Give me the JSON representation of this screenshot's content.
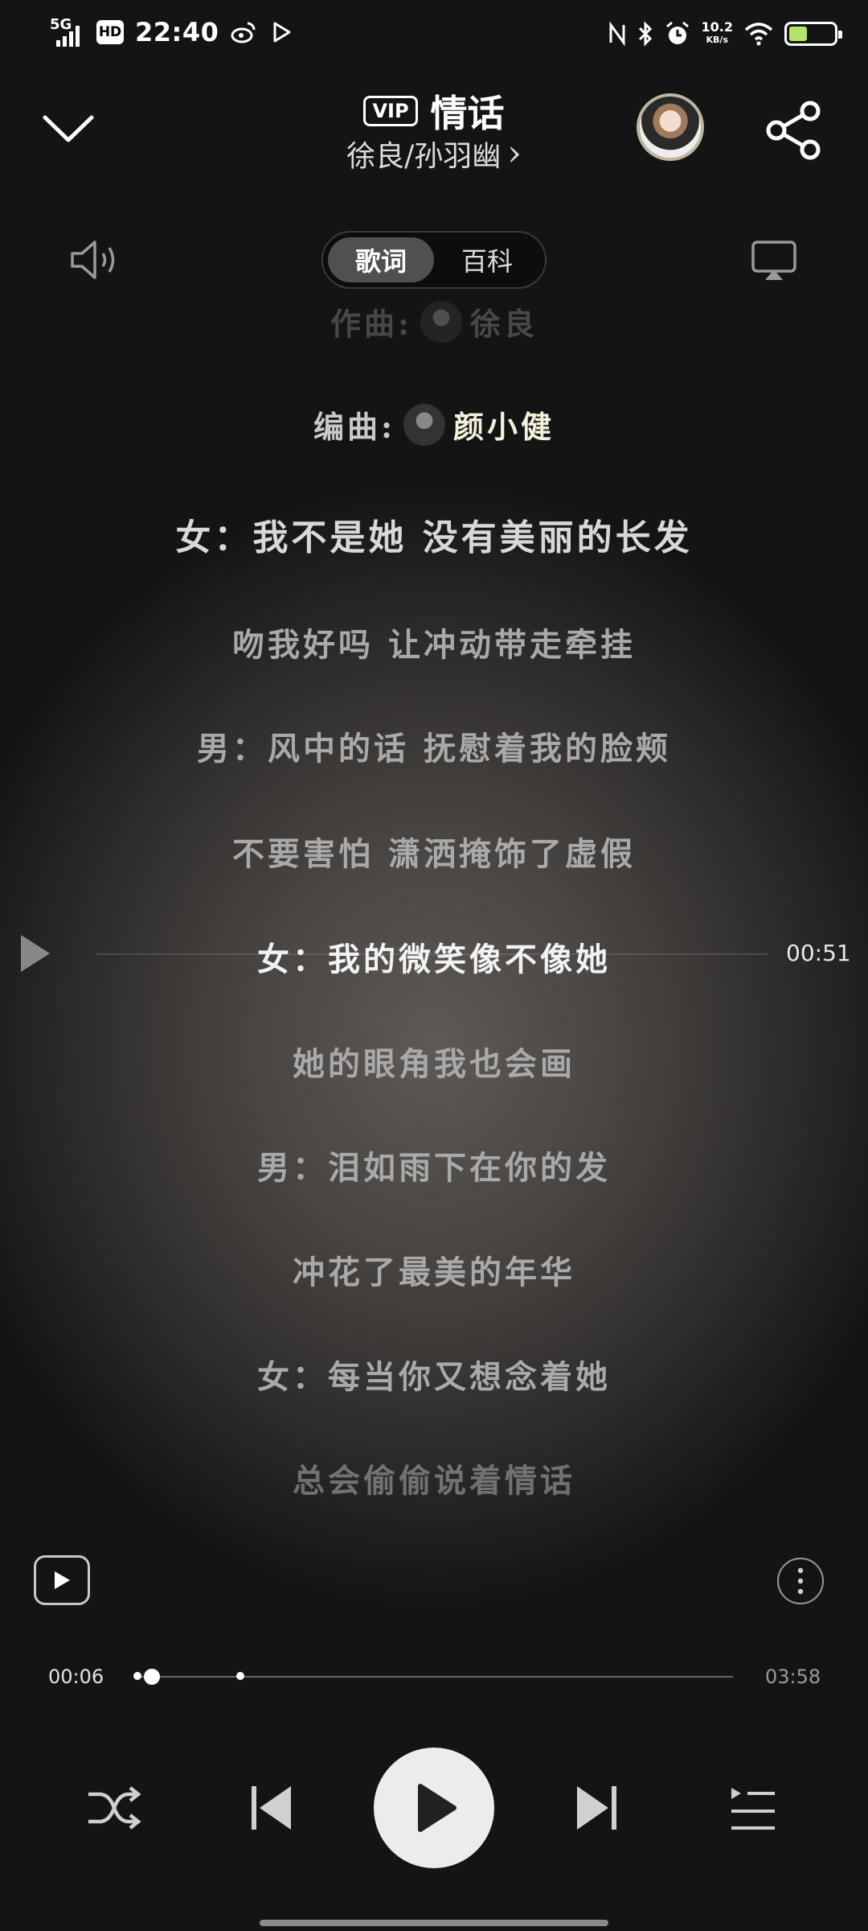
{
  "status_bar": {
    "network": "5G",
    "hd": "HD",
    "time": "22:40",
    "speed_value": "10.2",
    "speed_unit": "KB/s"
  },
  "header": {
    "vip_badge": "VIP",
    "song_title": "情话",
    "artists": "徐良/孙羽幽",
    "artists_chevron": "›"
  },
  "tabs": [
    {
      "label": "歌词",
      "active": true
    },
    {
      "label": "百科",
      "active": false
    }
  ],
  "lyrics": {
    "composer_label": "作曲:",
    "composer_name": "徐良",
    "arranger_label": "编曲:",
    "arranger_name": "颜小健",
    "lines": [
      "女：我不是她 没有美丽的长发",
      "吻我好吗 让冲动带走牵挂",
      "男：风中的话 抚慰着我的脸颊",
      "不要害怕 潇洒掩饰了虚假",
      "女：我的微笑像不像她",
      "她的眼角我也会画",
      "男：泪如雨下在你的发",
      "冲花了最美的年华",
      "女：每当你又想念着她",
      "总会偷偷说着情话"
    ],
    "seek_time": "00:51"
  },
  "player": {
    "elapsed": "00:06",
    "duration": "03:58",
    "progress": 0.025
  },
  "colors": {
    "background_center": "#5e5955",
    "background_edge": "#141414",
    "battery_fill": "#b6e36a"
  }
}
